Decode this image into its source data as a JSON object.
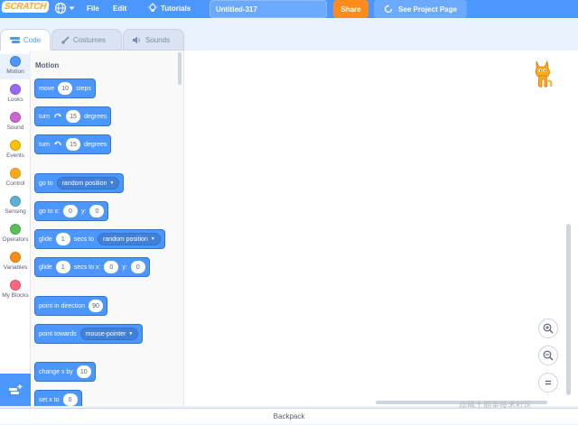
{
  "menubar": {
    "logo_text": "SCRATCH",
    "file_label": "File",
    "edit_label": "Edit",
    "tutorials_label": "Tutorials",
    "project_title": "Untitled-317",
    "share_label": "Share",
    "see_project_label": "See Project Page"
  },
  "tabs": [
    {
      "label": "Code",
      "active": true
    },
    {
      "label": "Costumes",
      "active": false
    },
    {
      "label": "Sounds",
      "active": false
    }
  ],
  "categories": [
    {
      "label": "Motion",
      "color": "#4c97ff"
    },
    {
      "label": "Looks",
      "color": "#9966ff"
    },
    {
      "label": "Sound",
      "color": "#cf63cf"
    },
    {
      "label": "Events",
      "color": "#ffbf00"
    },
    {
      "label": "Control",
      "color": "#ffab19"
    },
    {
      "label": "Sensing",
      "color": "#5cb1d6"
    },
    {
      "label": "Operators",
      "color": "#59c059"
    },
    {
      "label": "Variables",
      "color": "#ff8c1a"
    },
    {
      "label": "My Blocks",
      "color": "#ff6680"
    }
  ],
  "palette": {
    "section_title": "Motion",
    "blocks": {
      "move": {
        "label": "move",
        "value": "10",
        "suffix": "steps"
      },
      "turn_right": {
        "label": "turn",
        "value": "15",
        "suffix": "degrees"
      },
      "turn_left": {
        "label": "turn",
        "value": "15",
        "suffix": "degrees"
      },
      "goto": {
        "label": "go to",
        "option": "random position"
      },
      "goto_xy": {
        "label": "go to x:",
        "x": "0",
        "y_label": "y:",
        "y": "0"
      },
      "glide_to": {
        "label": "glide",
        "value": "1",
        "mid": "secs to",
        "option": "random position"
      },
      "glide_xy": {
        "label": "glide",
        "value": "1",
        "mid": "secs to x:",
        "x": "0",
        "y_label": "y:",
        "y": "0"
      },
      "point_dir": {
        "label": "point in direction",
        "value": "90"
      },
      "point_towards": {
        "label": "point towards",
        "option": "mouse-pointer"
      },
      "change_x": {
        "label": "change x by",
        "value": "10"
      },
      "set_x": {
        "label": "set x to",
        "value": "0"
      }
    }
  },
  "zoom": {
    "zoom_in": "+",
    "zoom_out": "−",
    "reset": "="
  },
  "backpack_label": "Backpack",
  "watermark": "@稀土掘金技术社区"
}
